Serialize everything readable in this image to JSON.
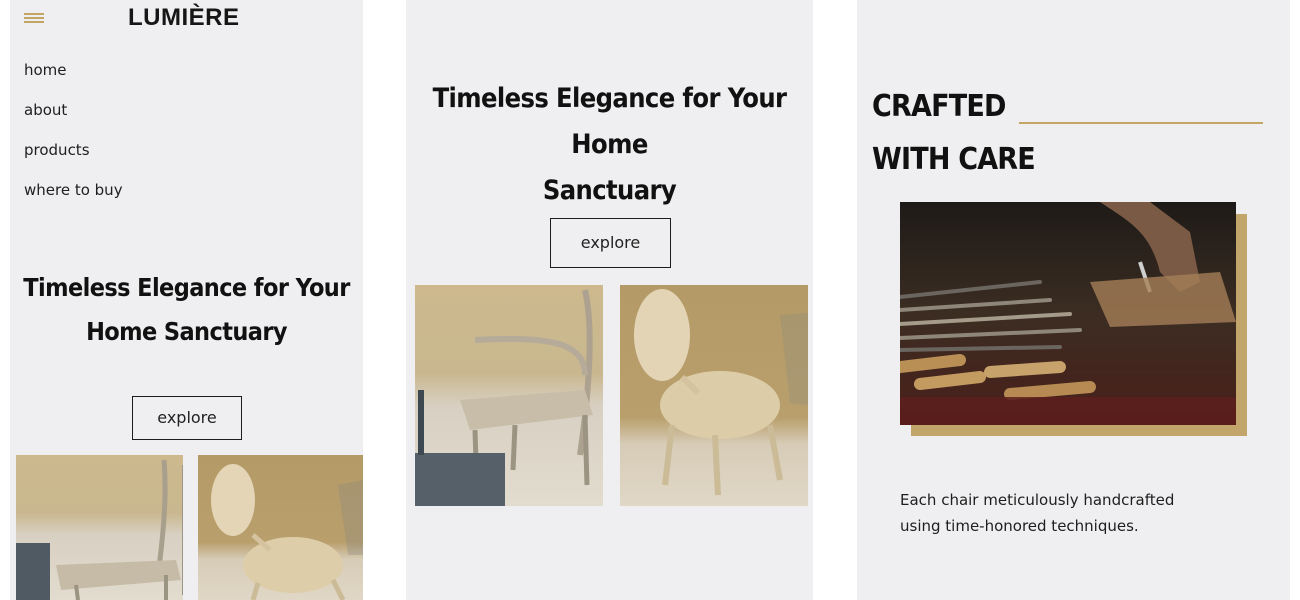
{
  "brand": {
    "name": "LUMIÈRE",
    "accent_color": "#c4a664"
  },
  "nav": {
    "items": [
      {
        "label": "home"
      },
      {
        "label": "about"
      },
      {
        "label": "products"
      },
      {
        "label": "where to buy"
      }
    ]
  },
  "hero": {
    "title_lines_mobile": [
      "Timeless Elegance for Your",
      "Home Sanctuary"
    ],
    "title_lines_tablet": [
      "Timeless Elegance for Your Home",
      "Sanctuary"
    ],
    "cta_label": "explore"
  },
  "craft": {
    "heading_lines": [
      "CRAFTED",
      "WITH CARE"
    ],
    "caption_lines": [
      "Each chair meticulously handcrafted",
      "using time-honored techniques."
    ]
  },
  "icons": {
    "menu": "hamburger-menu-icon"
  },
  "colors": {
    "panel_bg": "#efeef0",
    "text": "#111111",
    "accent": "#c4a664"
  }
}
